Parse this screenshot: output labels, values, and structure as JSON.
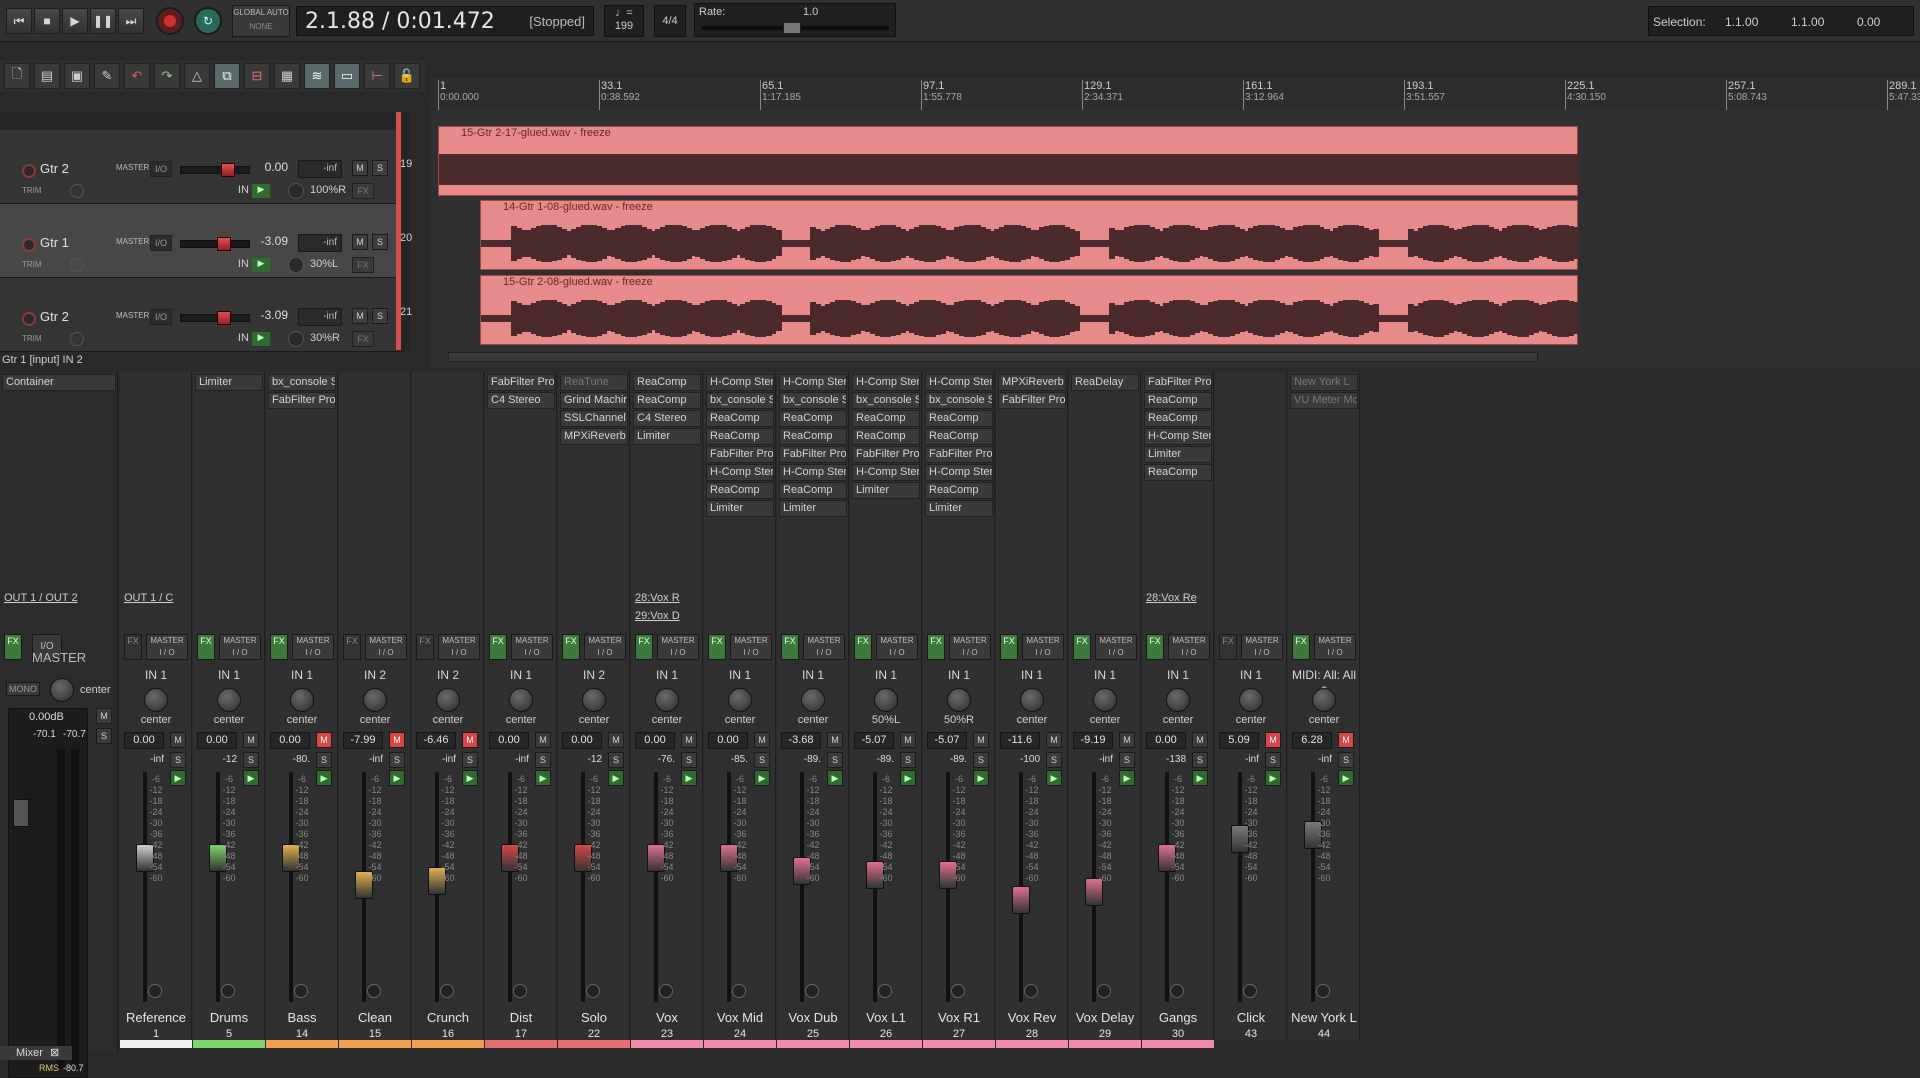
{
  "transport": {
    "global_auto": "GLOBAL AUTO",
    "global_auto_mode": "NONE",
    "time": "2.1.88 / 0:01.472",
    "state": "[Stopped]",
    "bpm_icon": "metronome-icon",
    "bpm": "199",
    "timesig": "4/4",
    "rate_label": "Rate:",
    "rate_value": "1.0",
    "selection_label": "Selection:",
    "sel_start": "1.1.00",
    "sel_end": "1.1.00",
    "sel_len": "0.00"
  },
  "ruler": [
    {
      "bar": "1",
      "time": "0:00.000"
    },
    {
      "bar": "33.1",
      "time": "0:38.592"
    },
    {
      "bar": "65.1",
      "time": "1:17.185"
    },
    {
      "bar": "97.1",
      "time": "1:55.778"
    },
    {
      "bar": "129.1",
      "time": "2:34.371"
    },
    {
      "bar": "161.1",
      "time": "3:12.964"
    },
    {
      "bar": "193.1",
      "time": "3:51.557"
    },
    {
      "bar": "225.1",
      "time": "4:30.150"
    },
    {
      "bar": "257.1",
      "time": "5:08.743"
    },
    {
      "bar": "289.1",
      "time": "5:47.336"
    }
  ],
  "tcp": {
    "tracks": [
      {
        "name": "Gtr 2",
        "tag": "MASTER",
        "io": "I/O",
        "vol": "0.00",
        "peak": "-inf",
        "input": "IN 2",
        "pan": "100%R",
        "num": "19",
        "trim": "TRIM",
        "selected": false
      },
      {
        "name": "Gtr 1",
        "tag": "MASTER",
        "io": "I/O",
        "vol": "-3.09",
        "peak": "-inf",
        "input": "IN 2",
        "pan": "30%L",
        "num": "20",
        "trim": "TRIM",
        "selected": true
      },
      {
        "name": "Gtr 2",
        "tag": "MASTER",
        "io": "I/O",
        "vol": "-3.09",
        "peak": "-inf",
        "input": "IN 2",
        "pan": "30%R",
        "num": "21",
        "trim": "TRIM",
        "selected": false
      }
    ],
    "status": "Gtr 1 [input] IN 2"
  },
  "items": [
    {
      "label": "15-Gtr 2-17-glued.wav - freeze"
    },
    {
      "label": "14-Gtr 1-08-glued.wav - freeze"
    },
    {
      "label": "15-Gtr 2-08-glued.wav - freeze"
    }
  ],
  "master": {
    "container": "Container",
    "out": "OUT 1 / OUT 2",
    "io": "I/O",
    "fx": "FX",
    "name": "MASTER",
    "mono": "MONO",
    "pan": "center",
    "vol": "0.00dB",
    "peak_l": "-70.1",
    "peak_r": "-70.7",
    "rms_label": "RMS",
    "rms": "-80.7"
  },
  "mixer": {
    "tab_label": "Mixer",
    "scale": [
      "-6",
      "-12",
      "-18",
      "-24",
      "-30",
      "-36",
      "-42",
      "-48",
      "-54",
      "-60"
    ],
    "strips": [
      {
        "name": "Reference",
        "num": "1",
        "fx": [],
        "send": [
          "OUT 1 / C"
        ],
        "in": "IN 1",
        "pan": "center",
        "vol": "0.00",
        "peak": "-inf",
        "color": "#f0f0f0",
        "fader": 0.62,
        "knob": "#cfcfcf",
        "fx_on": false,
        "mute": false
      },
      {
        "name": "Drums",
        "num": "5",
        "fx": [
          "Limiter"
        ],
        "send": [],
        "in": "IN 1",
        "pan": "center",
        "vol": "0.00",
        "peak": "-12",
        "color": "#7fd66a",
        "fader": 0.62,
        "knob": "#7fd66a",
        "fx_on": true,
        "mute": false
      },
      {
        "name": "Bass",
        "num": "14",
        "fx": [
          "bx_console S",
          "FabFilter Pro-"
        ],
        "send": [],
        "in": "IN 1",
        "pan": "center",
        "vol": "0.00",
        "peak": "-80.",
        "color": "#f0a050",
        "fader": 0.62,
        "knob": "#e0b050",
        "fx_on": true,
        "mute": true
      },
      {
        "name": "Clean",
        "num": "15",
        "fx": [],
        "send": [],
        "in": "IN 2",
        "pan": "center",
        "vol": "-7.99",
        "peak": "-inf",
        "color": "#f0a050",
        "fader": 0.48,
        "knob": "#e0b050",
        "fx_on": false,
        "mute": true
      },
      {
        "name": "Crunch",
        "num": "16",
        "fx": [],
        "send": [],
        "in": "IN 2",
        "pan": "center",
        "vol": "-6.46",
        "peak": "-inf",
        "color": "#f0a050",
        "fader": 0.5,
        "knob": "#e0b050",
        "fx_on": false,
        "mute": true
      },
      {
        "name": "Dist",
        "num": "17",
        "fx": [
          "FabFilter Pro-",
          "C4 Stereo"
        ],
        "send": [],
        "in": "IN 1",
        "pan": "center",
        "vol": "0.00",
        "peak": "-inf",
        "color": "#e67070",
        "fader": 0.62,
        "knob": "#d84848",
        "fx_on": true,
        "mute": false
      },
      {
        "name": "Solo",
        "num": "22",
        "fx": [
          "ReaTune",
          "Grind Machir",
          "SSLChannel",
          "MPXiReverb"
        ],
        "send": [],
        "in": "IN 2",
        "pan": "center",
        "vol": "0.00",
        "peak": "-12",
        "color": "#e67070",
        "fader": 0.62,
        "knob": "#d84848",
        "fx_on": true,
        "mute": false
      },
      {
        "name": "Vox",
        "num": "23",
        "fx": [
          "ReaComp",
          "ReaComp",
          "C4 Stereo",
          "Limiter"
        ],
        "send": [
          "28:Vox R",
          "29:Vox D"
        ],
        "in": "IN 1",
        "pan": "center",
        "vol": "0.00",
        "peak": "-76.",
        "color": "#f08aa8",
        "fader": 0.62,
        "knob": "#e07090",
        "fx_on": true,
        "mute": false
      },
      {
        "name": "Vox Mid",
        "num": "24",
        "fx": [
          "H-Comp Ster",
          "bx_console S",
          "ReaComp",
          "ReaComp",
          "FabFilter Pro-",
          "H-Comp Ster",
          "ReaComp",
          "Limiter"
        ],
        "send": [],
        "in": "IN 1",
        "pan": "center",
        "vol": "0.00",
        "peak": "-85.",
        "color": "#f08aa8",
        "fader": 0.62,
        "knob": "#e07090",
        "fx_on": true,
        "mute": false
      },
      {
        "name": "Vox Dub",
        "num": "25",
        "fx": [
          "H-Comp Ster",
          "bx_console S",
          "ReaComp",
          "ReaComp",
          "FabFilter Pro-",
          "H-Comp Ster",
          "ReaComp",
          "Limiter"
        ],
        "send": [],
        "in": "IN 1",
        "pan": "center",
        "vol": "-3.68",
        "peak": "-89.",
        "color": "#f08aa8",
        "fader": 0.55,
        "knob": "#e07090",
        "fx_on": true,
        "mute": false
      },
      {
        "name": "Vox L1",
        "num": "26",
        "fx": [
          "H-Comp Ster",
          "bx_console S",
          "ReaComp",
          "ReaComp",
          "FabFilter Pro-",
          "H-Comp Ster",
          "Limiter"
        ],
        "send": [],
        "in": "IN 1",
        "pan": "50%L",
        "vol": "-5.07",
        "peak": "-89.",
        "color": "#f08aa8",
        "fader": 0.53,
        "knob": "#e07090",
        "fx_on": true,
        "mute": false
      },
      {
        "name": "Vox R1",
        "num": "27",
        "fx": [
          "H-Comp Ster",
          "bx_console S",
          "ReaComp",
          "ReaComp",
          "FabFilter Pro-",
          "H-Comp Ster",
          "ReaComp",
          "Limiter"
        ],
        "send": [],
        "in": "IN 1",
        "pan": "50%R",
        "vol": "-5.07",
        "peak": "-89.",
        "color": "#f08aa8",
        "fader": 0.53,
        "knob": "#e07090",
        "fx_on": true,
        "mute": false
      },
      {
        "name": "Vox Rev",
        "num": "28",
        "fx": [
          "MPXiReverb",
          "FabFilter Pro-"
        ],
        "send": [],
        "in": "IN 1",
        "pan": "center",
        "vol": "-11.6",
        "peak": "-100",
        "color": "#f08aa8",
        "fader": 0.4,
        "knob": "#e07090",
        "fx_on": true,
        "mute": false
      },
      {
        "name": "Vox Delay",
        "num": "29",
        "fx": [
          "ReaDelay"
        ],
        "send": [],
        "in": "IN 1",
        "pan": "center",
        "vol": "-9.19",
        "peak": "-inf",
        "color": "#f08aa8",
        "fader": 0.44,
        "knob": "#e07090",
        "fx_on": true,
        "mute": false
      },
      {
        "name": "Gangs",
        "num": "30",
        "fx": [
          "FabFilter Pro-",
          "ReaComp",
          "ReaComp",
          "H-Comp Ster",
          "Limiter",
          "ReaComp"
        ],
        "send": [
          "28:Vox Re"
        ],
        "in": "IN 1",
        "pan": "center",
        "vol": "0.00",
        "peak": "-138",
        "color": "#f08aa8",
        "fader": 0.62,
        "knob": "#e07090",
        "fx_on": true,
        "mute": false
      },
      {
        "name": "Click",
        "num": "43",
        "fx": [],
        "send": [],
        "in": "IN 1",
        "pan": "center",
        "vol": "5.09",
        "peak": "-inf",
        "color": "#2a2a2a",
        "fader": 0.72,
        "knob": "#7a7a7a",
        "fx_on": false,
        "mute": true
      },
      {
        "name": "New York L",
        "num": "44",
        "fx": [
          "New York L",
          "VU Meter Mo"
        ],
        "send": [],
        "in": "MIDI: All: All c",
        "pan": "center",
        "vol": "6.28",
        "peak": "-inf",
        "color": "#2a2a2a",
        "fader": 0.74,
        "knob": "#7a7a7a",
        "fx_on": true,
        "mute": true,
        "fx_dim": true
      }
    ]
  }
}
